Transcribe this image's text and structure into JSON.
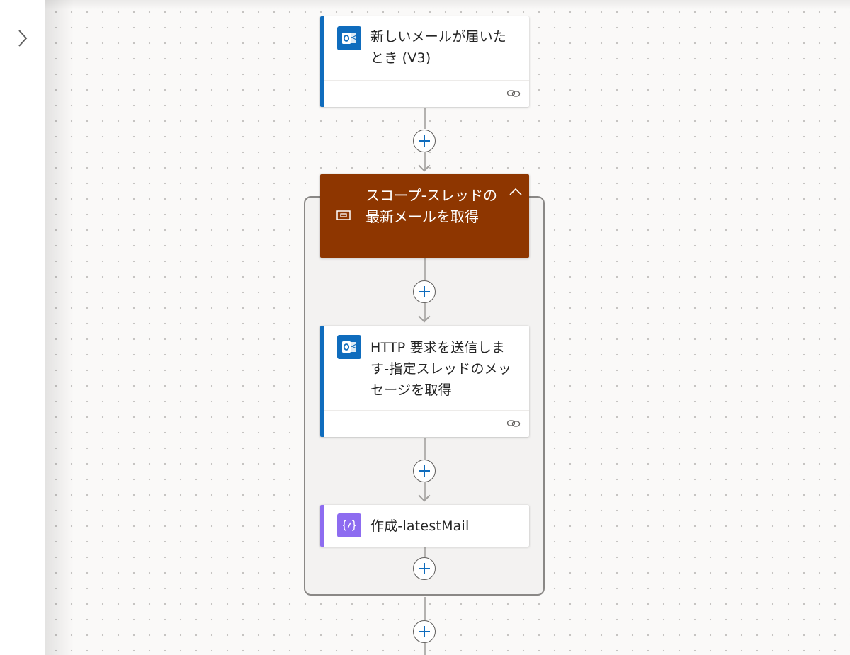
{
  "sidebar": {
    "expand_icon": "chevron-right-icon"
  },
  "flow": {
    "trigger": {
      "title": "新しいメールが届いたとき (V3)",
      "icon": "outlook-icon",
      "accent_color": "#0f6cbd",
      "footer_icon": "link-icon"
    },
    "scope": {
      "title": "スコープ-スレッドの最新メールを取得",
      "icon": "scope-icon",
      "header_color": "#8e3600",
      "collapse_icon": "chevron-up-icon",
      "actions": [
        {
          "title": "HTTP 要求を送信します-指定スレッドのメッセージを取得",
          "icon": "outlook-icon",
          "accent_color": "#0f6cbd",
          "footer_icon": "link-icon"
        },
        {
          "title": "作成-latestMail",
          "icon": "compose-icon",
          "accent_color": "#8d6cf0"
        }
      ]
    },
    "add_step_icon": "plus-icon"
  }
}
